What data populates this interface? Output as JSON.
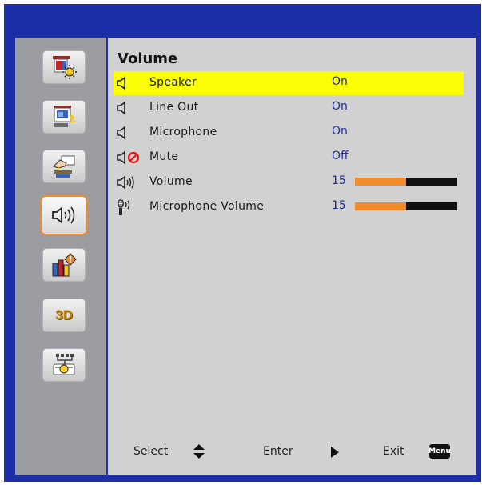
{
  "page": {
    "title": "Volume"
  },
  "sidebar": {
    "items": [
      {
        "name": "image-settings",
        "icon": "image-settings-icon"
      },
      {
        "name": "display-settings",
        "icon": "display-screen-icon"
      },
      {
        "name": "setup",
        "icon": "hand-setup-icon"
      },
      {
        "name": "volume",
        "icon": "speaker-volume-icon",
        "active": true
      },
      {
        "name": "options",
        "icon": "options-info-icon"
      },
      {
        "name": "3d",
        "icon": "3d-icon",
        "label": "3D"
      },
      {
        "name": "lan",
        "icon": "network-lan-icon"
      }
    ]
  },
  "rows": [
    {
      "label": "Speaker",
      "value": "On",
      "icon": "speaker-icon",
      "selected": true
    },
    {
      "label": "Line Out",
      "value": "On",
      "icon": "speaker-icon"
    },
    {
      "label": "Microphone",
      "value": "On",
      "icon": "speaker-icon"
    },
    {
      "label": "Mute",
      "value": "Off",
      "icon": "speaker-mute-icon"
    },
    {
      "label": "Volume",
      "value": "15",
      "icon": "volume-waves-icon",
      "level_fraction": 0.5
    },
    {
      "label": "Microphone Volume",
      "value": "15",
      "icon": "microphone-volume-icon",
      "level_fraction": 0.5
    }
  ],
  "footer": {
    "select_label": "Select",
    "enter_label": "Enter",
    "exit_label": "Exit",
    "menu_key_label": "Menu"
  },
  "colors": {
    "frame": "#1c2fa6",
    "selection": "#fbfd05",
    "slider_fill": "#f28c2a",
    "active_border": "#f08a2c",
    "value_text": "#1d2a9a"
  }
}
